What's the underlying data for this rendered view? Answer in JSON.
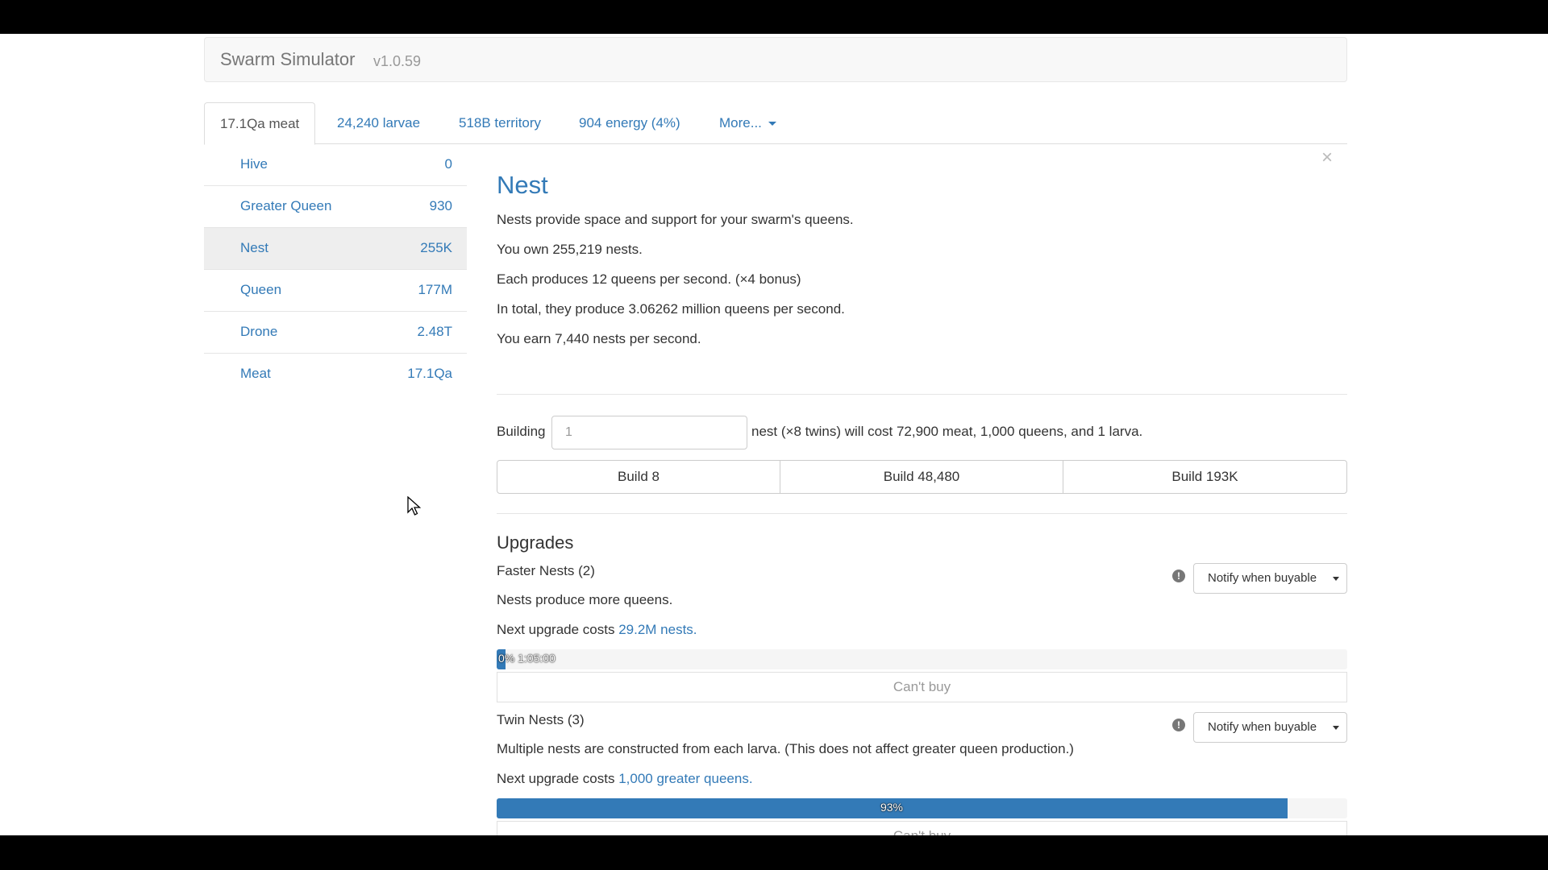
{
  "app": {
    "title": "Swarm Simulator",
    "version": "v1.0.59"
  },
  "tabs": [
    {
      "label": "17.1Qa meat",
      "active": true
    },
    {
      "label": "24,240 larvae"
    },
    {
      "label": "518B territory"
    },
    {
      "label": "904 energy (4%)"
    },
    {
      "label": "More..."
    }
  ],
  "sidebar": {
    "items": [
      {
        "name": "Hive",
        "count": "0"
      },
      {
        "name": "Greater Queen",
        "count": "930"
      },
      {
        "name": "Nest",
        "count": "255K",
        "active": true
      },
      {
        "name": "Queen",
        "count": "177M"
      },
      {
        "name": "Drone",
        "count": "2.48T"
      },
      {
        "name": "Meat",
        "count": "17.1Qa"
      }
    ]
  },
  "unit": {
    "close_label": "×",
    "title": "Nest",
    "description": "Nests provide space and support for your swarm's queens.",
    "owned": "You own 255,219 nests.",
    "each_produces": "Each produces 12 queens per second. (×4 bonus)",
    "total_produce": "In total, they produce 3.06262 million queens per second.",
    "earn": "You earn 7,440 nests per second.",
    "building_label": "Building",
    "building_value": "1",
    "cost_text": "nest (×8 twins) will cost 72,900 meat, 1,000 queens, and 1 larva.",
    "build_buttons": [
      "Build 8",
      "Build 48,480",
      "Build 193K"
    ]
  },
  "upgrades": {
    "title": "Upgrades",
    "items": [
      {
        "name": "Faster Nests (2)",
        "description": "Nests produce more queens.",
        "cost_prefix": "Next upgrade costs",
        "cost_link": "29.2M nests.",
        "progress": 0.01,
        "progress_label": "0% 1:05:00",
        "notify": "Notify when buyable",
        "action": "Can't buy"
      },
      {
        "name": "Twin Nests (3)",
        "description": "Multiple nests are constructed from each larva. (This does not affect greater queen production.)",
        "cost_prefix": "Next upgrade costs",
        "cost_link": "1,000 greater queens.",
        "progress": 0.93,
        "progress_label": "93%",
        "notify": "Notify when buyable",
        "action": "Can't buy"
      }
    ]
  },
  "colors": {
    "accent": "#337ab7",
    "muted": "#999999",
    "active_bg": "#eeeeee"
  },
  "icons": {
    "info": "info-icon",
    "dropdown": "chevron-down-icon",
    "cursor": "mouse-pointer-icon"
  }
}
